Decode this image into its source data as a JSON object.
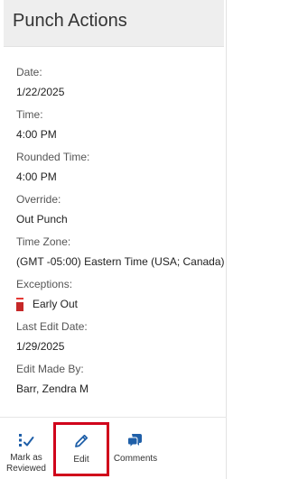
{
  "header": {
    "title": "Punch Actions"
  },
  "fields": [
    {
      "label": "Date:",
      "value": "1/22/2025"
    },
    {
      "label": "Time:",
      "value": "4:00 PM"
    },
    {
      "label": "Rounded Time:",
      "value": "4:00 PM"
    },
    {
      "label": "Override:",
      "value": "Out Punch"
    },
    {
      "label": "Time Zone:",
      "value": "(GMT -05:00) Eastern Time (USA; Canada)"
    },
    {
      "label": "Exceptions:",
      "value": "Early Out"
    },
    {
      "label": "Last Edit Date:",
      "value": "1/29/2025"
    },
    {
      "label": "Edit Made By:",
      "value": "Barr, Zendra M"
    }
  ],
  "footer": {
    "mark_reviewed_line1": "Mark as",
    "mark_reviewed_line2": "Reviewed",
    "edit_label": "Edit",
    "comments_label": "Comments"
  },
  "colors": {
    "accent": "#1f5fa8",
    "exception_flag": "#c62828",
    "highlight": "#d0021b",
    "header_bg": "#eeeeee"
  },
  "icons": {
    "mark_reviewed": "checklist-icon",
    "edit": "pencil-icon",
    "comments": "comment-bubble-icon",
    "exception": "red-flag-icon"
  }
}
